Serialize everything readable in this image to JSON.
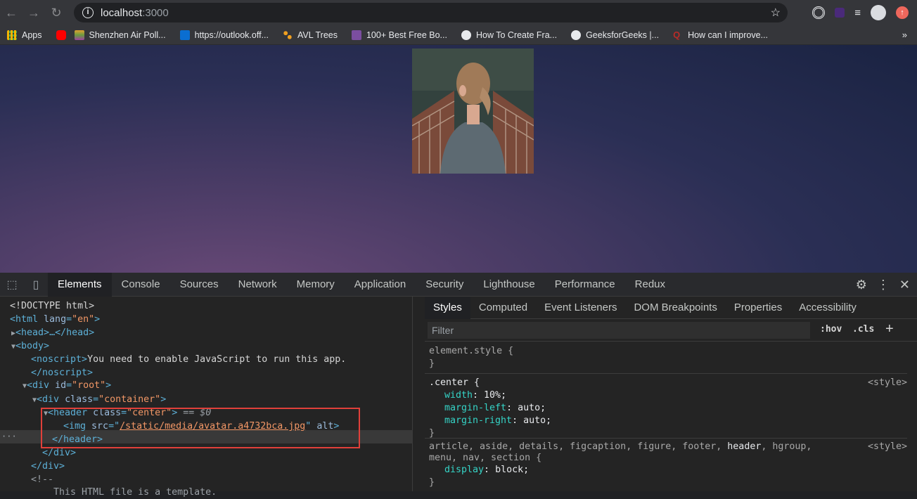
{
  "browser": {
    "url_host": "localhost",
    "url_port": ":3000",
    "bookmarks": [
      {
        "label": "Apps",
        "color": "#f4b400"
      },
      {
        "label": "",
        "color": "#ff0000"
      },
      {
        "label": "Shenzhen Air Poll...",
        "color": "#e0a030"
      },
      {
        "label": "https://outlook.off...",
        "color": "#0a6ed1"
      },
      {
        "label": "AVL Trees",
        "color": "#f0a020"
      },
      {
        "label": "100+ Best Free Bo...",
        "color": "#7b4ea0"
      },
      {
        "label": "How To Create Fra...",
        "color": "#e8eaed"
      },
      {
        "label": "GeeksforGeeks |...",
        "color": "#e8eaed"
      },
      {
        "label": "How can I improve...",
        "color": "#b92b27"
      }
    ],
    "bookmarks_more": "»"
  },
  "devtools": {
    "tabs": [
      "Elements",
      "Console",
      "Sources",
      "Network",
      "Memory",
      "Application",
      "Security",
      "Lighthouse",
      "Performance",
      "Redux"
    ],
    "active_tab": "Elements",
    "dom": {
      "doctype": "<!DOCTYPE html>",
      "html_open": "<html",
      "html_attr": "lang",
      "html_val": "\"en\"",
      "head": "<head>…</head>",
      "body_open": "<body>",
      "noscript_open": "<noscript>",
      "noscript_text": "You need to enable JavaScript to run this app.",
      "noscript_close": "</noscript>",
      "div_root_open": "<div",
      "div_root_attr": "id",
      "div_root_val": "\"root\"",
      "div_container_open": "<div",
      "div_container_attr": "class",
      "div_container_val": "\"container\"",
      "header_open": "<header",
      "header_attr": "class",
      "header_val": "\"center\"",
      "header_marker": "== $0",
      "img_open": "<img",
      "img_attr": "src",
      "img_val": "/static/media/avatar.a4732bca.jpg",
      "img_alt": "alt",
      "header_close": "</header>",
      "div_close": "</div>",
      "div_close2": "</div>",
      "comment": "<!--",
      "comment_text": "    This HTML file is a template."
    },
    "styles": {
      "tabs": [
        "Styles",
        "Computed",
        "Event Listeners",
        "DOM Breakpoints",
        "Properties",
        "Accessibility"
      ],
      "filter_placeholder": "Filter",
      "hov": ":hov",
      "cls": ".cls",
      "element_style": "element.style {",
      "center_selector": ".center {",
      "center_origin": "<style>",
      "center_props": [
        {
          "name": "width",
          "value": "10%;"
        },
        {
          "name": "margin-left",
          "value": "auto;"
        },
        {
          "name": "margin-right",
          "value": "auto;"
        }
      ],
      "block_selector_1": "article, aside, details, figcaption, figure, footer,",
      "block_selector_header": "header",
      "block_selector_2": ", hgroup,",
      "block_selector_3": "menu, nav, section {",
      "block_origin": "<style>",
      "block_prop_name": "display",
      "block_prop_value": "block;",
      "close_brace": "}"
    }
  }
}
